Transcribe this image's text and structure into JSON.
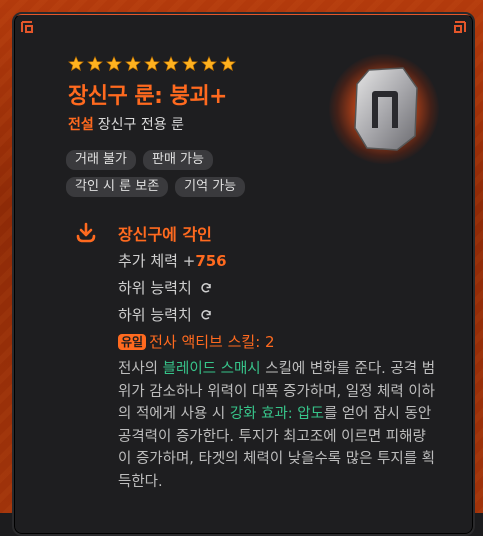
{
  "item": {
    "star_count": 9,
    "name": "장신구 룬: 붕괴+",
    "grade": "전설",
    "type": "장신구 전용 룬"
  },
  "tags": [
    [
      "거래 불가",
      "판매 가능"
    ],
    [
      "각인 시 룬 보존",
      "기억 가능"
    ]
  ],
  "engrave": {
    "title": "장신구에 각인",
    "stat_label": "추가 체력 +",
    "stat_value": "756",
    "sub_stat_1": "하위 능력치",
    "sub_stat_2": "하위 능력치",
    "unique_badge": "유일",
    "skill_label": "전사 액티브 스킬: 2"
  },
  "description": {
    "p1": "전사의 ",
    "p1_hl": "블레이드 스매시",
    "p2": " 스킬에 변화를 준다. 공격 범위가 감소하나 위력이 대폭 증가하며, 일정 체력 이하의 적에게 사용 시 ",
    "p2_hl": "강화 효과: 압도",
    "p3": "를 얻어 잠시 동안 공격력이 증가한다. 투지가 최고조에 이르면 피해량이 증가하며, 타겟의 체력이 낮을수록 많은 투지를 획득한다."
  },
  "colors": {
    "accent": "#ff6a1f",
    "highlight": "#37c48a",
    "frame": "#b33a0c",
    "panel": "#1e1e20",
    "tag_bg": "#3a3a3d"
  },
  "icons": {
    "star": "star-icon",
    "rune": "rune-icon",
    "engrave": "engrave-download-icon",
    "sync": "sync-icon"
  }
}
